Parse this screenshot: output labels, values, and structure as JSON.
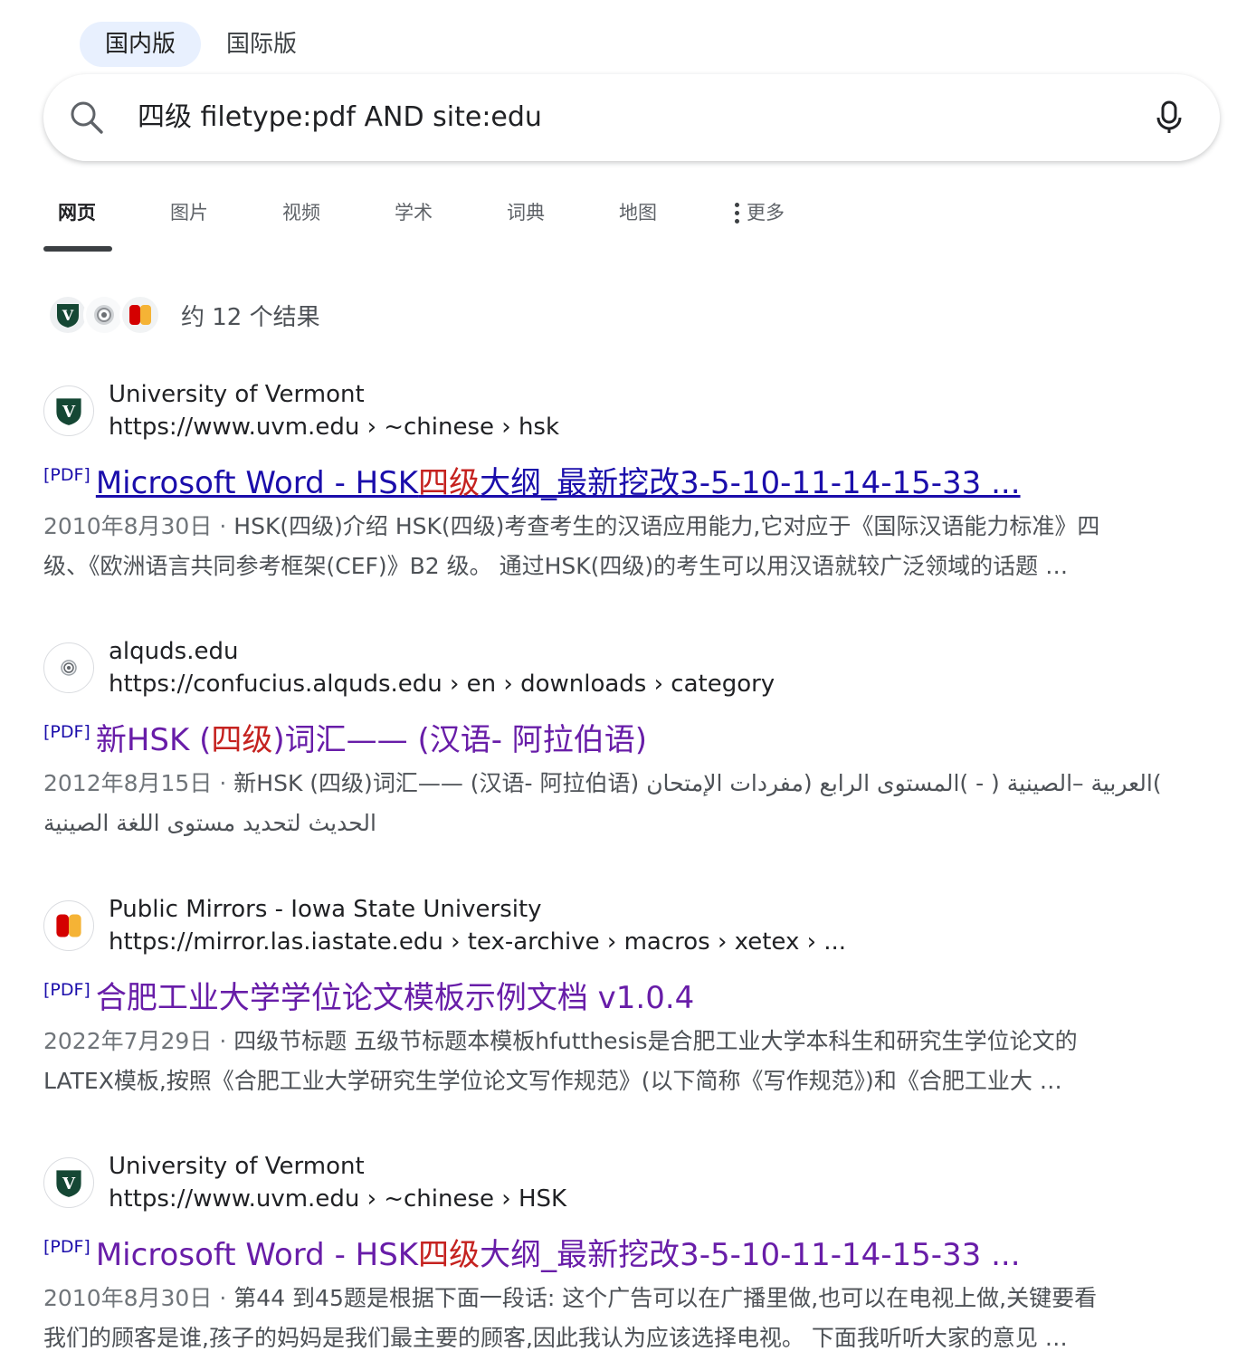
{
  "region": {
    "tabs": [
      "国内版",
      "国际版"
    ],
    "active": 0
  },
  "search": {
    "query": "四级 filetype:pdf AND site:edu",
    "icon": "search-icon",
    "mic_icon": "microphone-icon"
  },
  "tabs": [
    {
      "label": "网页",
      "active": true
    },
    {
      "label": "图片"
    },
    {
      "label": "视频"
    },
    {
      "label": "学术"
    },
    {
      "label": "词典"
    },
    {
      "label": "地图"
    }
  ],
  "more_label": "更多",
  "results_count": "约 12 个结果",
  "results": [
    {
      "site_name": "University of Vermont",
      "url": "https://www.uvm.edu › ~chinese › hsk",
      "favicon": "uvm",
      "pdf_tag": "[PDF]",
      "title_pre": "Microsoft Word - HSK",
      "title_hl": "四级",
      "title_post": "大纲_最新挖改3-5-10-11-14-15-33 ...",
      "date": "2010年8月30日",
      "snippet_1": "HSK(四级)介绍 HSK(四级)考查考生的汉语应用能力,它对应于《国际汉语能力标准》四",
      "snippet_2": "级、《欧洲语言共同参考框架(CEF)》B2 级。 通过HSK(四级)的考生可以用汉语就较广泛领域的话题 …"
    },
    {
      "site_name": "alquds.edu",
      "url": "https://confucius.alquds.edu › en › downloads › category",
      "favicon": "alquds",
      "pdf_tag": "[PDF]",
      "title_pre": "新HSK (",
      "title_hl": "四级",
      "title_post": ")词汇—— (汉语- 阿拉伯语)",
      "date": "2012年8月15日",
      "snippet_1": "新HSK (四级)词汇—— (汉语- 阿拉伯语) العربية –الصينية ( - )المستوى الرابع (مفردات الإمتحان(",
      "snippet_2": "الحديث لتحديد مستوى اللغة الصينية"
    },
    {
      "site_name": "Public Mirrors - Iowa State University",
      "url": "https://mirror.las.iastate.edu › tex-archive › macros › xetex › ...",
      "favicon": "iastate",
      "pdf_tag": "[PDF]",
      "title_pre": "合肥工业大学学位论文模板示例文档 v1.0.4",
      "title_hl": "",
      "title_post": "",
      "date": "2022年7月29日",
      "snippet_1": "四级节标题 五级节标题本模板hfutthesis是合肥工业大学本科生和研究生学位论文的",
      "snippet_2": "LATEX模板,按照《合肥工业大学研究生学位论文写作规范》(以下简称《写作规范》)和《合肥工业大 …"
    },
    {
      "site_name": "University of Vermont",
      "url": "https://www.uvm.edu › ~chinese › HSK",
      "favicon": "uvm",
      "pdf_tag": "[PDF]",
      "title_pre": "Microsoft Word - HSK",
      "title_hl": "四级",
      "title_post": "大纲_最新挖改3-5-10-11-14-15-33 ...",
      "date": "2010年8月30日",
      "snippet_1": "第44 到45题是根据下面一段话: 这个广告可以在广播里做,也可以在电视上做,关键要看",
      "snippet_2": "我们的顾客是谁,孩子的妈妈是我们最主要的顾客,因此我认为应该选择电视。 下面我听听大家的意见 …"
    }
  ],
  "separator": "·"
}
